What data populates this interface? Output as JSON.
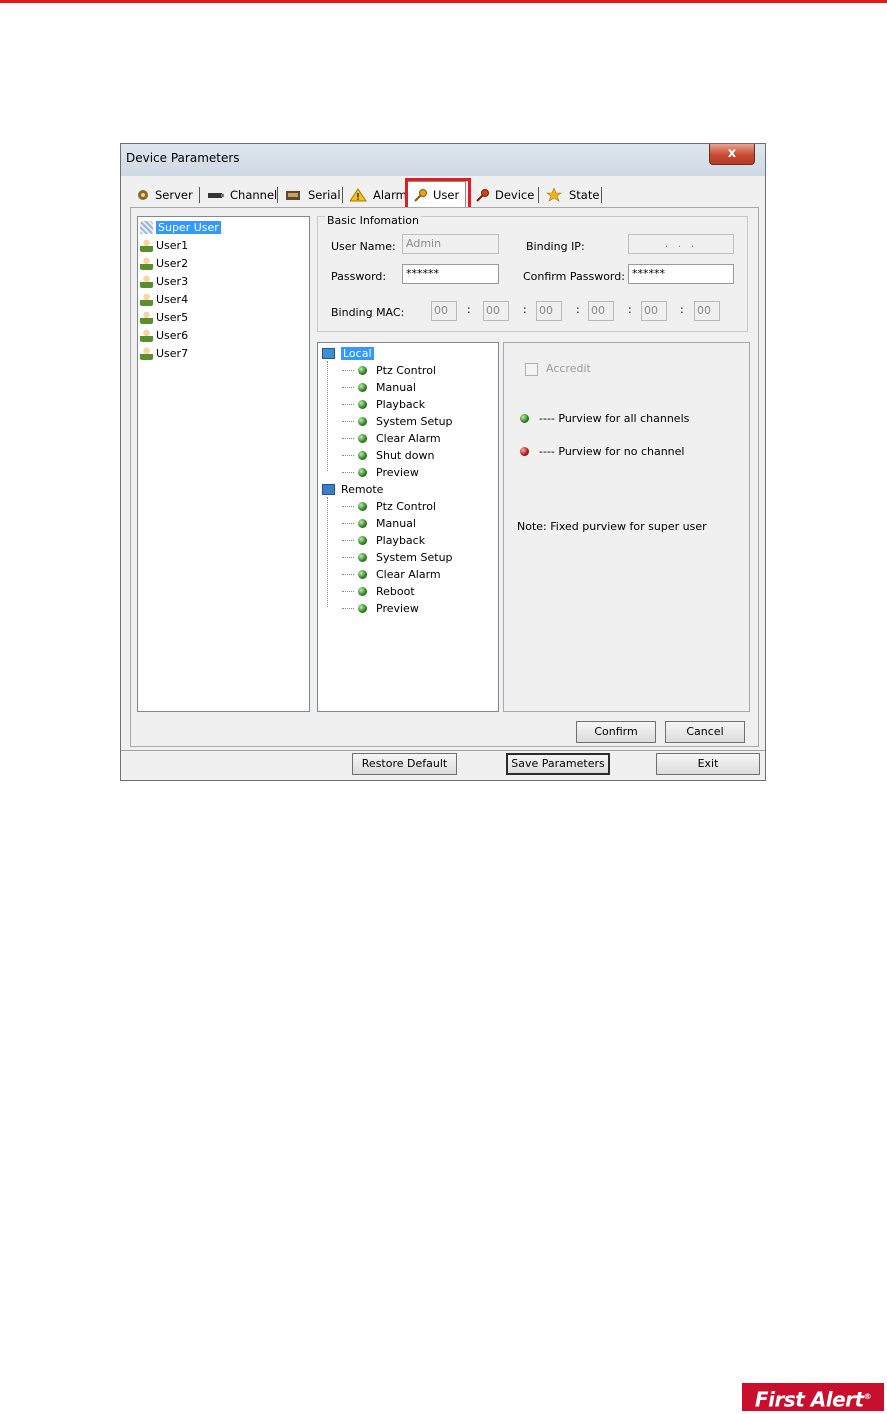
{
  "window": {
    "title": "Device Parameters",
    "close_label": "x"
  },
  "tabs": [
    {
      "label": "Server",
      "icon": "gear-icon"
    },
    {
      "label": "Channel",
      "icon": "camera-icon"
    },
    {
      "label": "Serial",
      "icon": "serial-icon"
    },
    {
      "label": "Alarm",
      "icon": "warning-icon"
    },
    {
      "label": "User",
      "icon": "key-icon",
      "active": true
    },
    {
      "label": "Device",
      "icon": "key-icon"
    },
    {
      "label": "State",
      "icon": "star-icon"
    }
  ],
  "users": [
    "Super User",
    "User1",
    "User2",
    "User3",
    "User4",
    "User5",
    "User6",
    "User7"
  ],
  "basic": {
    "legend": "Basic Infomation",
    "user_name_label": "User Name:",
    "user_name_value": "Admin",
    "binding_ip_label": "Binding IP:",
    "binding_ip_value": ".    .    .",
    "password_label": "Password:",
    "password_value": "******",
    "confirm_password_label": "Confirm Password:",
    "confirm_password_value": "******",
    "binding_mac_label": "Binding MAC:",
    "mac": [
      "00",
      "00",
      "00",
      "00",
      "00",
      "00"
    ],
    "mac_sep": ":"
  },
  "tree": {
    "local": {
      "label": "Local",
      "items": [
        "Ptz Control",
        "Manual",
        "Playback",
        "System Setup",
        "Clear Alarm",
        "Shut down",
        "Preview"
      ]
    },
    "remote": {
      "label": "Remote",
      "items": [
        "Ptz Control",
        "Manual",
        "Playback",
        "System Setup",
        "Clear Alarm",
        "Reboot",
        "Preview"
      ]
    }
  },
  "right": {
    "accredit_label": "Accredit",
    "all_channels": "----  Purview for all channels",
    "no_channel": "----  Purview for no channel",
    "note": "Note: Fixed purview for super user"
  },
  "buttons": {
    "confirm": "Confirm",
    "cancel": "Cancel",
    "restore_default": "Restore Default",
    "save_parameters": "Save Parameters",
    "exit": "Exit"
  },
  "brand": {
    "logo_text": "First Alert",
    "logo_mark": "®",
    "accent_color": "#e21a1a"
  }
}
